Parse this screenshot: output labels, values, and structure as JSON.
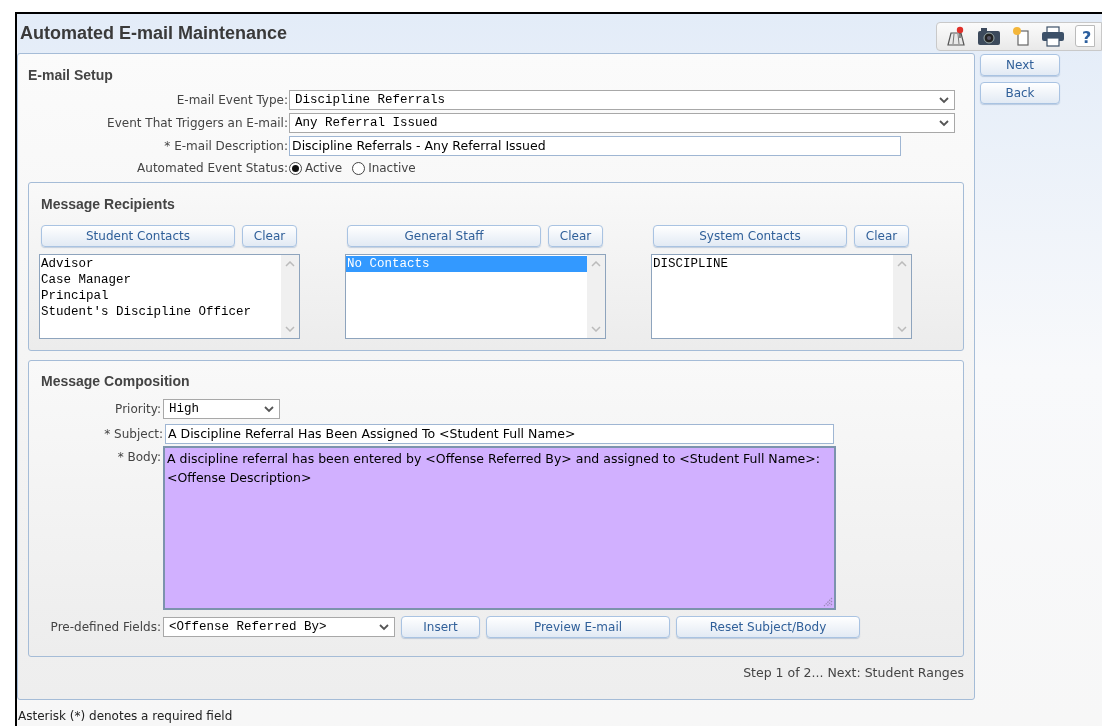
{
  "window": {
    "title": "Automated E-mail Maintenance"
  },
  "toolbar": {
    "help": "?"
  },
  "side_buttons": [
    "Next",
    "Back"
  ],
  "email_setup": {
    "heading": "E-mail Setup",
    "fields": [
      {
        "kind": "select",
        "label": "E-mail Event Type:",
        "value": "Discipline Referrals"
      },
      {
        "kind": "select",
        "label": "Event That Triggers an E-mail:",
        "value": "Any Referral Issued"
      },
      {
        "kind": "text",
        "label": "* E-mail Description:",
        "value": "Discipline Referrals - Any Referral Issued"
      }
    ],
    "status": {
      "label": "Automated Event Status:",
      "options": [
        {
          "label": "Active",
          "selected": true
        },
        {
          "label": "Inactive",
          "selected": false
        }
      ]
    }
  },
  "message_recipients": {
    "heading": "Message Recipients",
    "groups": [
      {
        "button": "Student Contacts",
        "clear": "Clear",
        "items": [
          {
            "text": "Advisor",
            "selected": false
          },
          {
            "text": "Case Manager",
            "selected": false
          },
          {
            "text": "Principal",
            "selected": false
          },
          {
            "text": "Student's Discipline Officer",
            "selected": false
          }
        ]
      },
      {
        "button": "General Staff",
        "clear": "Clear",
        "items": [
          {
            "text": "No Contacts",
            "selected": true
          }
        ]
      },
      {
        "button": "System Contacts",
        "clear": "Clear",
        "items": [
          {
            "text": "DISCIPLINE",
            "selected": false
          }
        ]
      }
    ]
  },
  "message_composition": {
    "heading": "Message Composition",
    "priority": {
      "label": "Priority:",
      "value": "High"
    },
    "subject": {
      "label": "* Subject:",
      "value": "A Discipline Referral Has Been Assigned To <Student Full Name>"
    },
    "body": {
      "label": "* Body:",
      "lines": [
        "A discipline referral has been entered by <Offense Referred By> and assigned to <Student Full Name>:",
        "<Offense Description>"
      ]
    },
    "predefined": {
      "label": "Pre-defined Fields:",
      "value": "<Offense Referred By>"
    },
    "buttons": [
      "Insert",
      "Preview E-mail",
      "Reset Subject/Body"
    ]
  },
  "step_text": "Step 1 of 2... Next: Student Ranges",
  "footer": "Asterisk (*) denotes a required field"
}
